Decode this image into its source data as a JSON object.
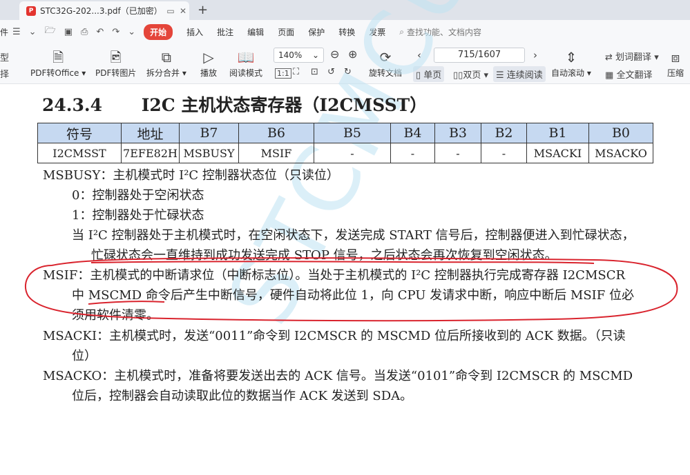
{
  "tab": {
    "title": "STC32G-202...3.pdf（已加密）",
    "icon": "pdf-icon",
    "add": "+"
  },
  "menu": {
    "file": "件",
    "start": "开始",
    "items": [
      "插入",
      "批注",
      "编辑",
      "页面",
      "保护",
      "转换",
      "发票"
    ],
    "search_placeholder": "查找功能、文档内容"
  },
  "toolbar": {
    "left_top": "型",
    "left_bottom": "择",
    "pdf_to_office": "PDF转Office",
    "pdf_to_image": "PDF转图片",
    "split_merge": "拆分合并",
    "play": "播放",
    "read_mode": "阅读模式",
    "zoom": "140%",
    "fit": "1:1",
    "rotate": "旋转文档",
    "page": "715/1607",
    "single_page": "单页",
    "double_page": "双页",
    "continuous": "连续阅读",
    "auto_scroll": "自动滚动",
    "word_translate": "划词翻译",
    "full_translate": "全文翻译",
    "compress": "压缩"
  },
  "doc": {
    "heading_num": "24.3.4",
    "heading_text": "I2C 主机状态寄存器（I2CMSST）",
    "table": {
      "headers": [
        "符号",
        "地址",
        "B7",
        "B6",
        "B5",
        "B4",
        "B3",
        "B2",
        "B1",
        "B0"
      ],
      "row": [
        "I2CMSST",
        "7EFE82H",
        "MSBUSY",
        "MSIF",
        "-",
        "-",
        "-",
        "-",
        "MSACKI",
        "MSACKO"
      ]
    },
    "lines": [
      "MSBUSY：主机模式时 I²C 控制器状态位（只读位）",
      "0：控制器处于空闲状态",
      "1：控制器处于忙碌状态",
      "当 I²C 控制器处于主机模式时，在空闲状态下，发送完成 START 信号后，控制器便进入到忙碌状态，",
      "忙碌状态会一直维持到成功发送完成 STOP 信号，之后状态会再次恢复到空闲状态。",
      "MSIF：主机模式的中断请求位（中断标志位）。当处于主机模式的 I²C 控制器执行完成寄存器 I2CMSCR",
      "中 MSCMD 命令后产生中断信号，硬件自动将此位 1，向 CPU 发请求中断，响应中断后 MSIF 位必",
      "须用软件清零。",
      "MSACKI：主机模式时，发送“0011”命令到 I2CMSCR 的 MSCMD 位后所接收到的 ACK 数据。（只读",
      "位）",
      "MSACKO：主机模式时，准备将要发送出去的 ACK 信号。当发送“0101”命令到 I2CMSCR 的 MSCMD",
      "位后，控制器会自动读取此位的数据当作 ACK 发送到 SDA。"
    ]
  },
  "colors": {
    "header_bg": "#c6d9f1",
    "annotation": "#d9232d",
    "start_btn": "#e4453a"
  }
}
